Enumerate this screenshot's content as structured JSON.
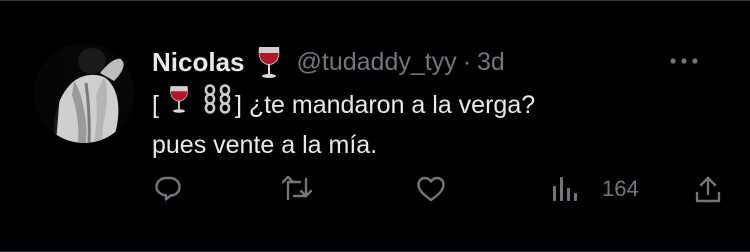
{
  "tweet": {
    "display_name": "Nicolas",
    "name_emoji": "wine-glass",
    "handle": "@tudaddy_tyy",
    "separator": "·",
    "time": "3d",
    "text_line1_open": "[",
    "text_line1_close": "] ¿te mandaron a la verga?",
    "text_line2": "pues vente a la mía.",
    "views": "164"
  },
  "icons": [
    "reply-icon",
    "retweet-icon",
    "like-icon",
    "views-icon",
    "share-icon",
    "more-icon"
  ],
  "colors": {
    "background": "#000000",
    "text": "#e7e9ea",
    "muted": "#71767b",
    "wine": "#b3162b"
  }
}
